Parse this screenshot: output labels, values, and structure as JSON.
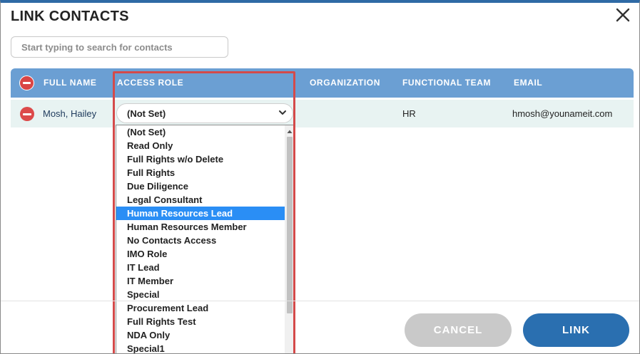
{
  "dialog": {
    "title": "LINK CONTACTS",
    "close_icon": "close-icon"
  },
  "search": {
    "placeholder": "Start typing to search for contacts",
    "value": ""
  },
  "table": {
    "headers": {
      "full_name": "FULL NAME",
      "access_role": "ACCESS ROLE",
      "organization": "ORGANIZATION",
      "functional_team": "FUNCTIONAL TEAM",
      "email": "EMAIL"
    },
    "rows": [
      {
        "full_name": "Mosh, Hailey",
        "access_role": "(Not Set)",
        "organization": "",
        "functional_team": "HR",
        "email": "hmosh@younameit.com"
      }
    ]
  },
  "dropdown": {
    "options": [
      "(Not Set)",
      "Read Only",
      "Full Rights w/o Delete",
      "Full Rights",
      "Due Diligence",
      "Legal Consultant",
      "Human Resources Lead",
      "Human Resources Member",
      "No Contacts Access",
      "IMO Role",
      "IT Lead",
      "IT Member",
      "Special",
      "Procurement Lead",
      "Full Rights Test",
      "NDA Only",
      "Special1"
    ],
    "highlighted": "Human Resources Lead"
  },
  "footer": {
    "cancel_label": "CANCEL",
    "link_label": "LINK"
  },
  "colors": {
    "header_bg": "#6b9fd3",
    "row_bg": "#e8f3f2",
    "remove_red": "#d94545",
    "highlight_border": "#d44a4a",
    "selected_option": "#2a8ef5",
    "link_button": "#2a6fb0",
    "cancel_button": "#c9c9c9"
  }
}
